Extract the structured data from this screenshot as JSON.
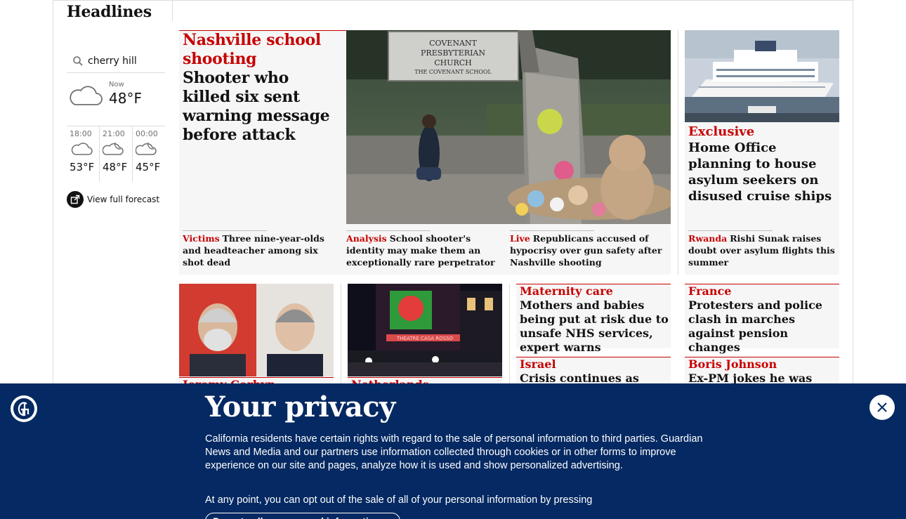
{
  "section": {
    "title": "Headlines"
  },
  "weather": {
    "location": "cherry hill",
    "now_label": "Now",
    "now_temp": "48°F",
    "forecast": [
      {
        "time": "18:00",
        "temp": "53°F",
        "icon": "cloud-icon"
      },
      {
        "time": "21:00",
        "temp": "48°F",
        "icon": "night-cloud-icon"
      },
      {
        "time": "00:00",
        "temp": "45°F",
        "icon": "night-cloud-icon"
      }
    ],
    "full_forecast_label": "View full forecast"
  },
  "lead": {
    "kicker": "Nashville school shooting",
    "headline": "Shooter who killed six sent warning message before attack",
    "image_alt": "Person kneeling at memorial outside Covenant Presbyterian Church",
    "sign_line1": "COVENANT",
    "sign_line2": "PRESBYTERIAN",
    "sign_line3": "CHURCH",
    "sign_line4": "THE COVENANT SCHOOL",
    "sublinks": [
      {
        "kicker": "Victims",
        "text": "Three nine-year-olds and headteacher among six shot dead"
      },
      {
        "kicker": "Analysis",
        "text": "School shooter's identity may make them an exceptionally rare perpetrator"
      },
      {
        "kicker": "Live",
        "text": "Republicans accused of hypocrisy over gun safety after Nashville shooting"
      }
    ]
  },
  "cruise": {
    "kicker": "Exclusive",
    "headline": "Home Office planning to house asylum seekers on disused cruise ships",
    "sublink": {
      "kicker": "Rwanda",
      "text": "Rishi Sunak raises doubt over asylum flights this summer"
    }
  },
  "row2": {
    "corbyn": {
      "kicker": "Jeremy Corbyn"
    },
    "netherlands": {
      "kicker": "Netherlands",
      "club_sign": "THEATRE CASA ROSSO"
    },
    "maternity": {
      "kicker": "Maternity care",
      "headline": "Mothers and babies being put at risk due to unsafe NHS services, expert warns"
    },
    "france": {
      "kicker": "France",
      "headline": "Protesters and police clash in marches against pension changes"
    },
    "israel": {
      "kicker": "Israel",
      "headline": "Crisis continues as fired"
    },
    "boris": {
      "kicker": "Boris Johnson",
      "headline": "Ex-PM jokes he was given"
    }
  },
  "privacy": {
    "title": "Your privacy",
    "body": "California residents have certain rights with regard to the sale of personal information to third parties. Guardian News and Media and our partners use information collected through cookies or in other forms to improve experience on our site and pages, analyze how it is used and show personalized advertising.",
    "body2": "At any point, you can opt out of the sale of all of your personal information by pressing",
    "button": "Do not sell my personal information"
  },
  "colors": {
    "news_red": "#c70000",
    "brand_blue": "#052962",
    "card_bg": "#f6f6f6"
  }
}
